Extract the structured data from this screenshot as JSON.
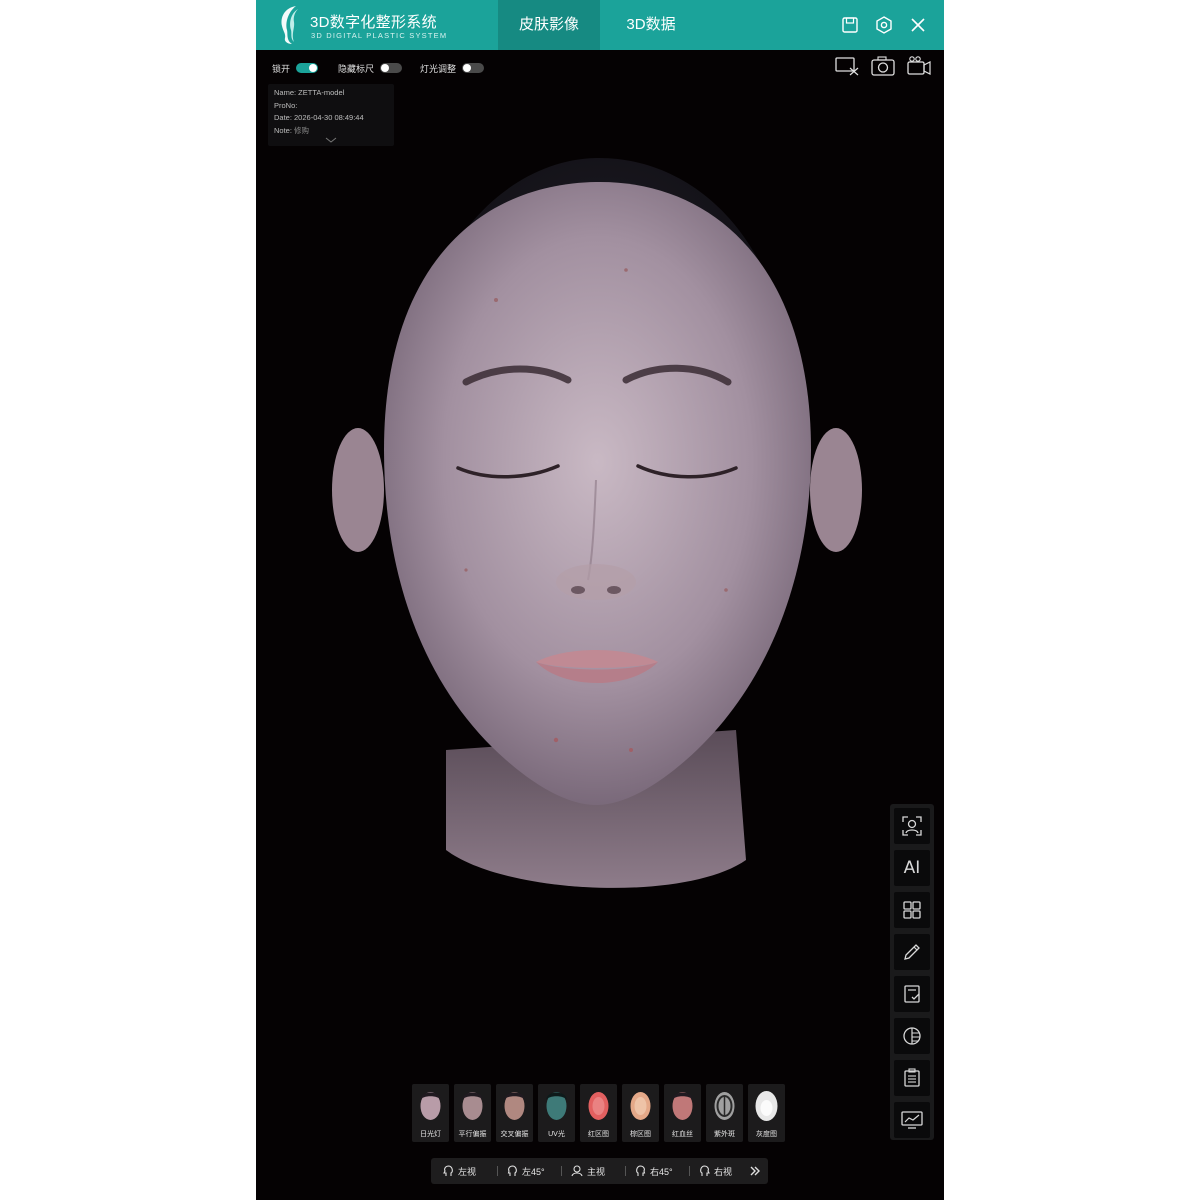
{
  "app": {
    "title": "3D数字化整形系统",
    "subtitle": "3D DIGITAL PLASTIC SYSTEM",
    "accent_color": "#1ba39a"
  },
  "header": {
    "tabs": [
      {
        "label": "皮肤影像",
        "active": true
      },
      {
        "label": "3D数据",
        "active": false
      }
    ],
    "icons": [
      "save-icon",
      "settings-icon",
      "close-icon"
    ]
  },
  "toggles": [
    {
      "label": "锁开",
      "on": true
    },
    {
      "label": "隐藏标尺",
      "on": false
    },
    {
      "label": "灯光调整",
      "on": false
    }
  ],
  "info": {
    "name": "Name: ZETTA-model",
    "prono": "ProNo:",
    "date": "Date: 2026-04-30 08:49:44",
    "note_label": "Note: ",
    "note_value": "修购"
  },
  "media_icons": [
    "screenshot-crop-icon",
    "camera-icon",
    "video-icon"
  ],
  "tools": [
    {
      "icon": "face-scan-icon"
    },
    {
      "icon": "ai-icon",
      "label": "AI"
    },
    {
      "icon": "grid-icon"
    },
    {
      "icon": "pen-icon"
    },
    {
      "icon": "report-check-icon"
    },
    {
      "icon": "contrast-icon"
    },
    {
      "icon": "clipboard-icon"
    },
    {
      "icon": "chart-monitor-icon"
    }
  ],
  "thumbnails": [
    {
      "label": "日光灯",
      "tint": "#b89ca8",
      "active": false
    },
    {
      "label": "平行偏振",
      "tint": "#a88c90",
      "active": false
    },
    {
      "label": "交叉偏振",
      "tint": "#b08880",
      "active": false
    },
    {
      "label": "UV光",
      "tint": "#3e7a78",
      "active": false
    },
    {
      "label": "红区图",
      "tint": "#e26060",
      "active": false
    },
    {
      "label": "棕区图",
      "tint": "#e4a888",
      "active": false
    },
    {
      "label": "红血丝",
      "tint": "#c07878",
      "active": false
    },
    {
      "label": "紫外斑",
      "tint": "#a0a0a0",
      "active": false
    },
    {
      "label": "灰度图",
      "tint": "#e8e8e8",
      "active": false
    }
  ],
  "views": [
    {
      "label": "左视",
      "icon": "head-left-icon"
    },
    {
      "label": "左45°",
      "icon": "head-left45-icon"
    },
    {
      "label": "主视",
      "icon": "head-front-icon"
    },
    {
      "label": "右45°",
      "icon": "head-right45-icon"
    },
    {
      "label": "右视",
      "icon": "head-right-icon"
    }
  ]
}
